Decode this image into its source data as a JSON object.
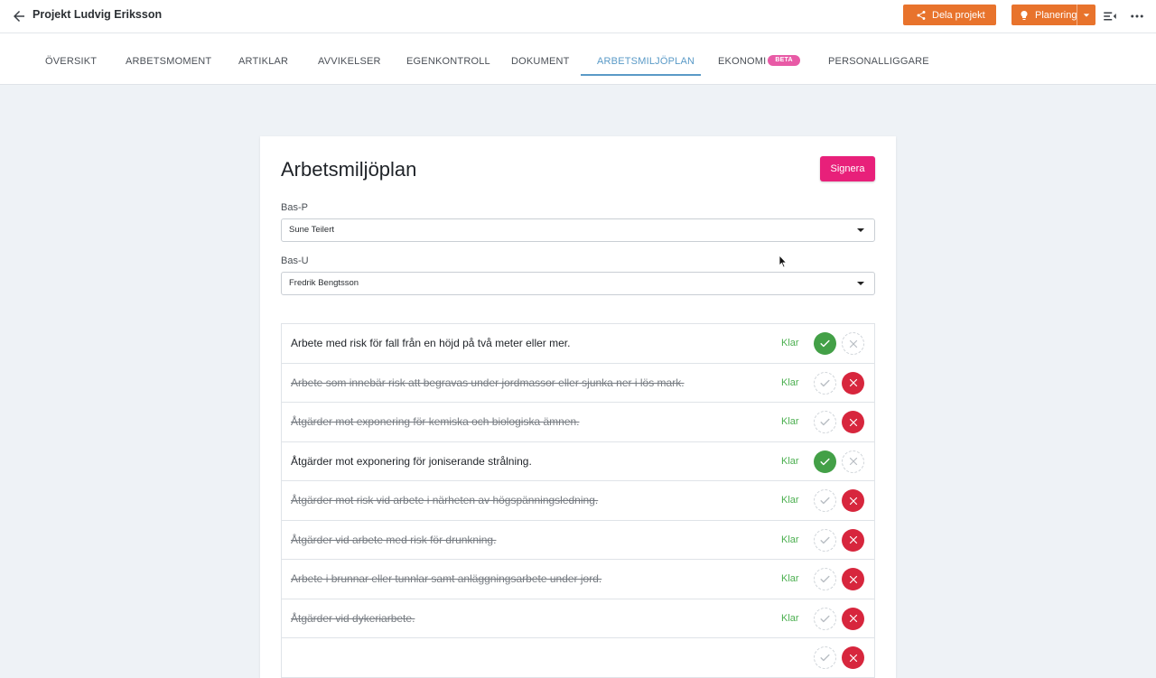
{
  "header": {
    "title": "Projekt Ludvig Eriksson",
    "share_label": "Dela projekt",
    "plan_label": "Planering"
  },
  "tabs": [
    {
      "label": "ÖVERSIKT"
    },
    {
      "label": "ARBETSMOMENT"
    },
    {
      "label": "ARTIKLAR"
    },
    {
      "label": "AVVIKELSER"
    },
    {
      "label": "EGENKONTROLL"
    },
    {
      "label": "DOKUMENT"
    },
    {
      "label": "ARBETSMILJÖPLAN",
      "active": true
    },
    {
      "label": "EKONOMI",
      "badge": "BETA"
    },
    {
      "label": "PERSONALLIGGARE"
    }
  ],
  "card": {
    "title": "Arbetsmiljöplan",
    "sign_label": "Signera",
    "basp_label": "Bas-P",
    "basp_value": "Sune Teilert",
    "basu_label": "Bas-U",
    "basu_value": "Fredrik Bengtsson"
  },
  "items": [
    {
      "text": "Arbete med risk för fall från en höjd på två meter eller mer.",
      "status": "Klar",
      "state": "yes"
    },
    {
      "text": "Arbete som innebär risk att begravas under jordmassor eller sjunka ner i lös mark.",
      "status": "Klar",
      "state": "no"
    },
    {
      "text": "Åtgärder mot exponering för kemiska och biologiska ämnen.",
      "status": "Klar",
      "state": "no"
    },
    {
      "text": "Åtgärder mot exponering för joniserande strålning.",
      "status": "Klar",
      "state": "yes"
    },
    {
      "text": "Åtgärder mot risk vid arbete i närheten av högspänningsledning.",
      "status": "Klar",
      "state": "no"
    },
    {
      "text": "Åtgärder vid arbete med risk för drunkning.",
      "status": "Klar",
      "state": "no"
    },
    {
      "text": "Arbete i brunnar eller tunnlar samt anläggningsarbete under jord.",
      "status": "Klar",
      "state": "no"
    },
    {
      "text": "Åtgärder vid dykeriarbete.",
      "status": "Klar",
      "state": "no"
    },
    {
      "text": "",
      "status": "",
      "state": "no"
    }
  ],
  "colors": {
    "accent_orange": "#e8732c",
    "sign_pink": "#e8207a",
    "tab_active": "#5a9ac7",
    "check_green": "#43a047",
    "cross_red": "#d7263d",
    "klar_green": "#4caf50"
  },
  "icons": {
    "back": "arrow-left-icon",
    "share": "share-icon",
    "plan": "lightbulb-icon",
    "list": "list-collapse-icon",
    "more": "more-horizontal-icon",
    "check": "check-icon",
    "cross": "close-icon"
  }
}
